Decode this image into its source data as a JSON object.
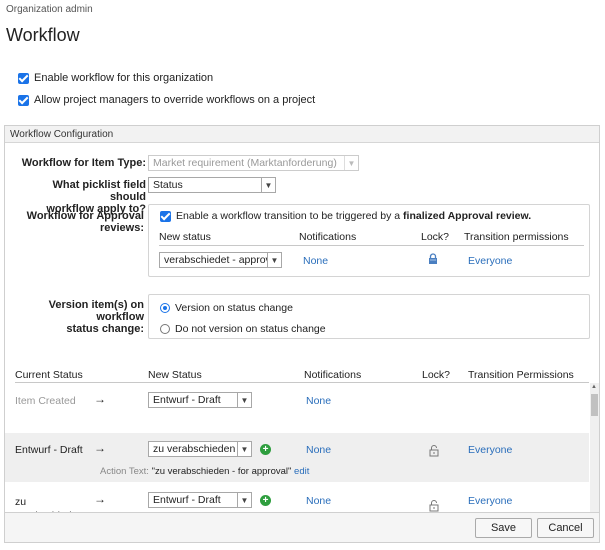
{
  "header": {
    "breadcrumb": "Organization admin",
    "title": "Workflow"
  },
  "options": {
    "enable_workflow": "Enable workflow for this organization",
    "allow_override": "Allow project managers to override workflows on a project"
  },
  "config": {
    "panel_title": "Workflow Configuration",
    "item_type_label": "Workflow for Item Type:",
    "item_type_value": "Market requirement (Marktanforderung)",
    "picklist_label_1": "What picklist field should",
    "picklist_label_2": "workflow apply to?",
    "picklist_value": "Status",
    "approval_label_1": "Workflow for Approval",
    "approval_label_2": "reviews:",
    "approval_checkbox_prefix": "Enable a workflow transition to be triggered by a ",
    "approval_checkbox_bold": "finalized Approval review.",
    "approval_cols": {
      "new_status": "New status",
      "notifications": "Notifications",
      "lock": "Lock?",
      "permissions": "Transition permissions"
    },
    "approval_row": {
      "status": "verabschiedet - approved",
      "notifications": "None",
      "permissions": "Everyone"
    },
    "version_label_1": "Version item(s) on workflow",
    "version_label_2": "status change:",
    "version_on": "Version on status change",
    "version_off": "Do not version on status change"
  },
  "table": {
    "headers": {
      "current": "Current Status",
      "new": "New Status",
      "notifications": "Notifications",
      "lock": "Lock?",
      "permissions": "Transition Permissions"
    },
    "arrow": "→",
    "rows": [
      {
        "current": "Item Created",
        "new": "Entwurf - Draft",
        "notifications": "None",
        "permissions": ""
      },
      {
        "current": "Entwurf - Draft",
        "new": "zu verabschieden - for approval",
        "notifications": "None",
        "permissions": "Everyone",
        "action_label": "Action Text:",
        "action_text": "\"zu verabschieden - for approval\"",
        "action_edit": "edit"
      },
      {
        "current": "zu verabschieden - for approval",
        "new": "Entwurf - Draft",
        "notifications": "None",
        "permissions": "Everyone"
      }
    ]
  },
  "footer": {
    "save": "Save",
    "cancel": "Cancel"
  },
  "colors": {
    "accent": "#1a73e8",
    "link": "#2a6ebb",
    "add": "#2e9e3e"
  }
}
